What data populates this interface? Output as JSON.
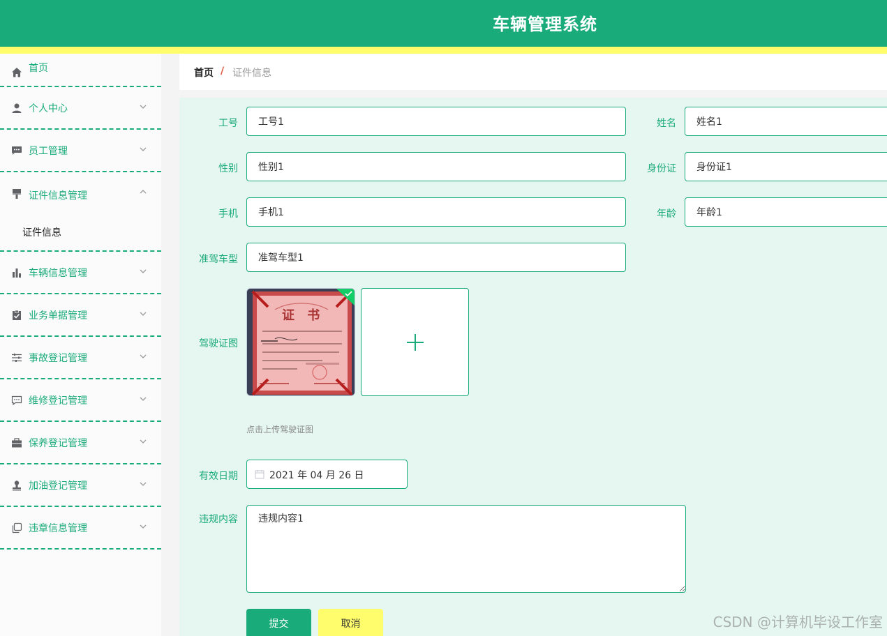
{
  "header": {
    "title": "车辆管理系统"
  },
  "colors": {
    "primary": "#1aab7a",
    "accent": "#fffd6b",
    "breadcrumb_sep": "#e0553a"
  },
  "sidebar": {
    "items": [
      {
        "label": "首页",
        "icon": "home-icon"
      },
      {
        "label": "个人中心",
        "icon": "user-icon"
      },
      {
        "label": "员工管理",
        "icon": "chat-icon"
      },
      {
        "label": "证件信息管理",
        "icon": "brush-icon",
        "open": true,
        "sub": "证件信息"
      },
      {
        "label": "车辆信息管理",
        "icon": "bar-chart-icon"
      },
      {
        "label": "业务单据管理",
        "icon": "clipboard-check-icon"
      },
      {
        "label": "事故登记管理",
        "icon": "sliders-icon"
      },
      {
        "label": "维修登记管理",
        "icon": "message-icon"
      },
      {
        "label": "保养登记管理",
        "icon": "briefcase-icon"
      },
      {
        "label": "加油登记管理",
        "icon": "stamp-icon"
      },
      {
        "label": "违章信息管理",
        "icon": "copy-icon"
      }
    ]
  },
  "breadcrumb": {
    "home": "首页",
    "separator": "/",
    "current": "证件信息"
  },
  "form": {
    "labels": {
      "gonghao": "工号",
      "xingming": "姓名",
      "xingbie": "性别",
      "shenfenzheng": "身份证",
      "shouji": "手机",
      "nianling": "年龄",
      "zhunjiachexing": "准驾车型",
      "jiashizhengtu": "驾驶证图",
      "youxiaoriqi": "有效日期",
      "weiguineirong": "违规内容"
    },
    "values": {
      "gonghao": "工号1",
      "xingming": "姓名1",
      "xingbie": "性别1",
      "shenfenzheng": "身份证1",
      "shouji": "手机1",
      "nianling": "年龄1",
      "zhunjiachexing": "准驾车型1",
      "youxiaoriqi": "2021 年 04 月 26 日",
      "weiguineirong": "违规内容1"
    },
    "upload": {
      "tip": "点击上传驾驶证图",
      "thumb_title": "证 书",
      "success_icon": "check-icon",
      "add_icon": "plus-icon"
    },
    "buttons": {
      "submit": "提交",
      "cancel": "取消"
    }
  },
  "watermark": "CSDN @计算机毕设工作室"
}
